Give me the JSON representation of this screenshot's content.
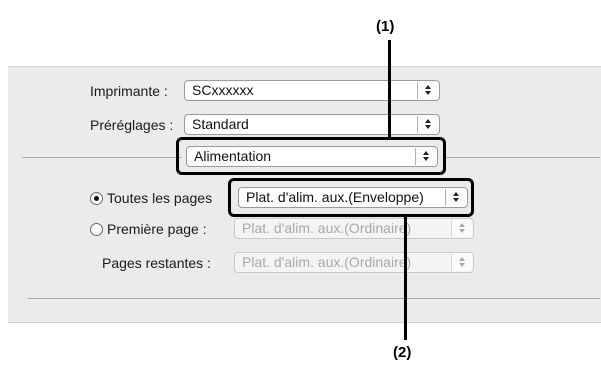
{
  "dialog": {
    "printer_label": "Imprimante :",
    "printer_value": "SCxxxxxx",
    "presets_label": "Préréglages :",
    "presets_value": "Standard",
    "section_value": "Alimentation",
    "all_pages_label": "Toutes les pages",
    "all_pages_value": "Plat. d'alim. aux.(Enveloppe)",
    "first_page_label": "Première page :",
    "first_page_value": "Plat. d'alim. aux.(Ordinaire)",
    "remaining_label": "Pages restantes :",
    "remaining_value": "Plat. d'alim. aux.(Ordinaire)"
  },
  "callouts": {
    "one": "(1)",
    "two": "(2)"
  }
}
